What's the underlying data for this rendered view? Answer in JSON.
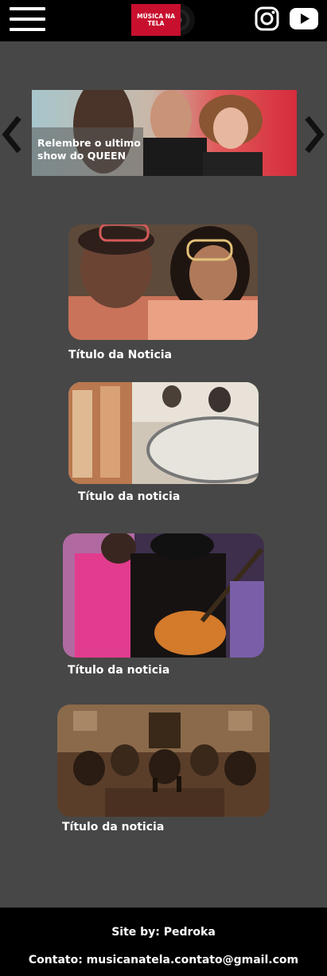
{
  "header": {
    "logo_text": "MÚSICA NA TELA",
    "menu_icon": "hamburger-menu-icon",
    "instagram_icon": "instagram-icon",
    "youtube_icon": "youtube-icon"
  },
  "carousel": {
    "caption": "Relembre o ultimo show do QUEEN",
    "prev_icon": "chevron-left-icon",
    "next_icon": "chevron-right-icon"
  },
  "news": [
    {
      "title": "Título da Noticia"
    },
    {
      "title": "Título da noticia"
    },
    {
      "title": "Título da noticia"
    },
    {
      "title": "Título da noticia"
    }
  ],
  "footer": {
    "credits": "Site by: Pedroka",
    "contact": "Contato: musicanatela.contato@gmail.com"
  },
  "colors": {
    "background": "#474747",
    "bars": "#000000",
    "logo_red": "#c8102e"
  }
}
